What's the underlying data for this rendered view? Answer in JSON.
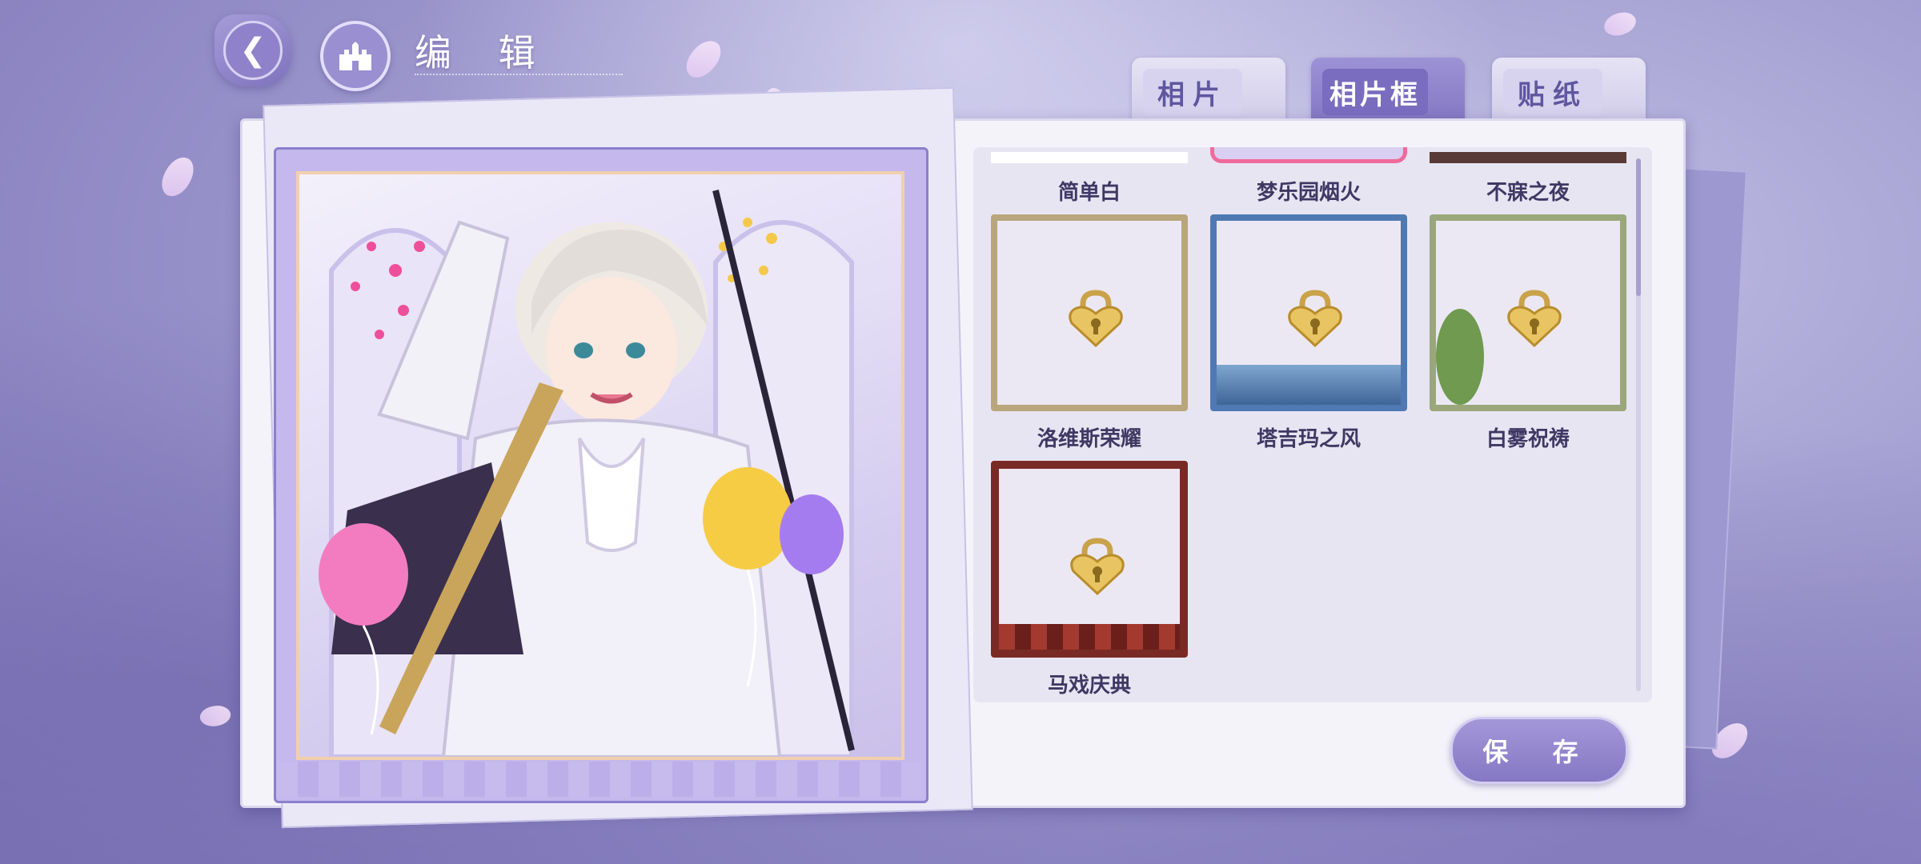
{
  "header": {
    "title": "编 辑"
  },
  "tabs": [
    {
      "label": "相片",
      "active": false
    },
    {
      "label": "相片框",
      "active": true
    },
    {
      "label": "贴纸",
      "active": false
    }
  ],
  "frames": {
    "top_row": [
      {
        "name": "简单白",
        "selected": false
      },
      {
        "name": "梦乐园烟火",
        "selected": true
      },
      {
        "name": "不寐之夜",
        "selected": false
      }
    ],
    "items": [
      {
        "name": "洛维斯荣耀",
        "locked": true
      },
      {
        "name": "塔吉玛之风",
        "locked": true
      },
      {
        "name": "白雾祝祷",
        "locked": true
      },
      {
        "name": "马戏庆典",
        "locked": true
      }
    ]
  },
  "save_label": "保 存",
  "colors": {
    "accent": "#8578c4",
    "selected_border": "#f06a9a",
    "lock_gold": "#e9c462"
  }
}
